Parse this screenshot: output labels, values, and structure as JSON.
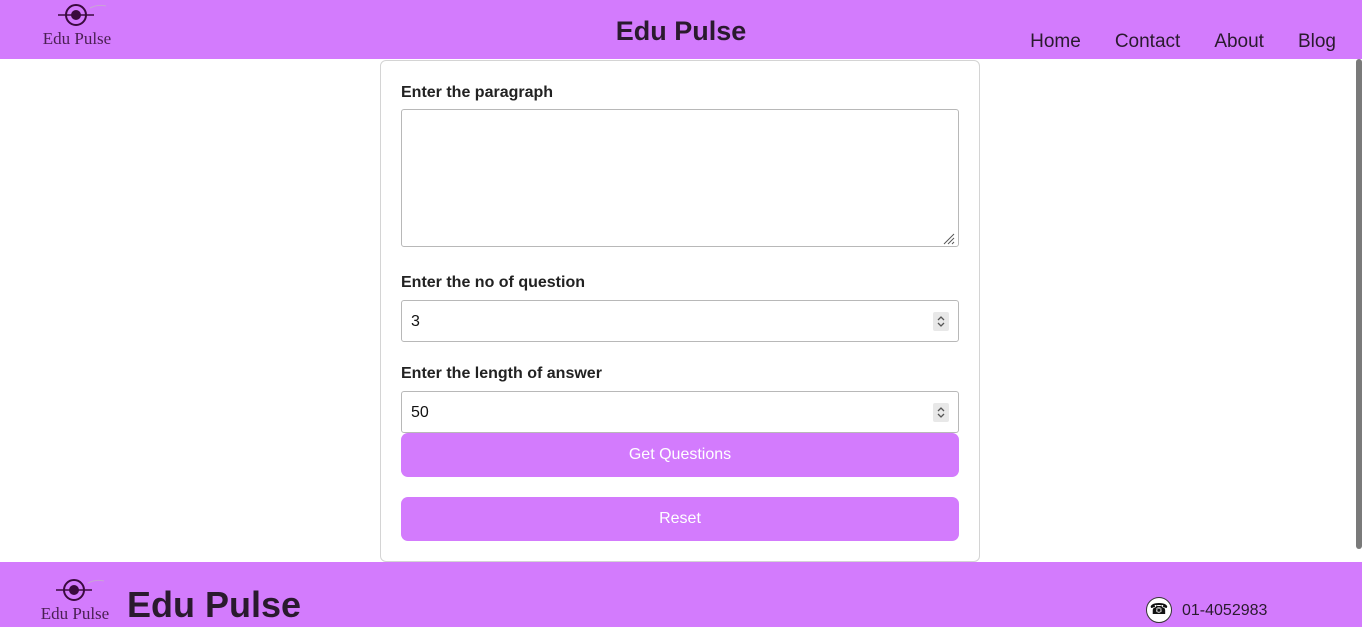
{
  "header": {
    "logo_text": "Edu Pulse",
    "title": "Edu Pulse",
    "nav": [
      "Home",
      "Contact",
      "About",
      "Blog"
    ]
  },
  "form": {
    "paragraph_label": "Enter the paragraph",
    "paragraph_value": "",
    "questions_label": "Enter the no of question",
    "questions_value": "3",
    "answer_length_label": "Enter the length of answer",
    "answer_length_value": "50",
    "get_questions_label": "Get Questions",
    "reset_label": "Reset"
  },
  "footer": {
    "logo_text": "Edu Pulse",
    "title": "Edu Pulse",
    "phone_icon": "telephone-icon",
    "phone": "01-4052983"
  },
  "colors": {
    "brand": "#d37bfd",
    "text_dark": "#2a1a2e",
    "button_text": "#ffffff"
  }
}
